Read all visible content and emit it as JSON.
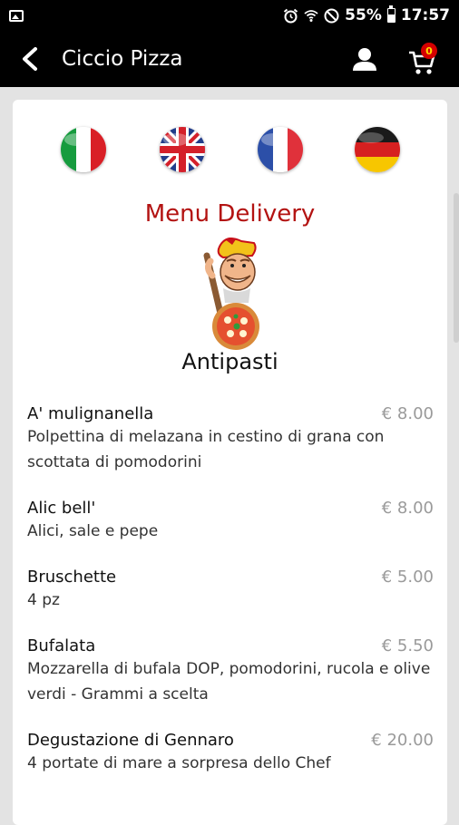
{
  "status_bar": {
    "battery": "55%",
    "time": "17:57",
    "icons": [
      "image-notification-icon",
      "alarm-icon",
      "wifi-icon",
      "do-not-disturb-icon",
      "battery-icon"
    ]
  },
  "app_bar": {
    "title": "Ciccio Pizza",
    "cart_count": "0",
    "icons": [
      "back-arrow-icon",
      "user-icon",
      "cart-icon"
    ]
  },
  "languages": [
    {
      "flag": "italian-flag",
      "lang": "it"
    },
    {
      "flag": "uk-flag",
      "lang": "en"
    },
    {
      "flag": "french-flag",
      "lang": "fr"
    },
    {
      "flag": "german-flag",
      "lang": "de"
    }
  ],
  "menu": {
    "title": "Menu Delivery",
    "section": "Antipasti",
    "items": [
      {
        "name": "A' mulignanella",
        "price": "€ 8.00",
        "description": "Polpettina di melazana in cestino di grana con scottata di pomodorini"
      },
      {
        "name": "Alic bell'",
        "price": "€ 8.00",
        "description": "Alici, sale e pepe"
      },
      {
        "name": "Bruschette",
        "price": "€ 5.00",
        "description": "4 pz"
      },
      {
        "name": "Bufalata",
        "price": "€ 5.50",
        "description": "Mozzarella di bufala DOP, pomodorini, rucola e olive verdi - Grammi a scelta"
      },
      {
        "name": "Degustazione di Gennaro",
        "price": "€ 20.00",
        "description": "4 portate di mare a sorpresa dello Chef"
      }
    ]
  },
  "colors": {
    "accent": "#b31312",
    "bar": "#000000",
    "background": "#e3e3e3",
    "badge": "#d40000"
  }
}
